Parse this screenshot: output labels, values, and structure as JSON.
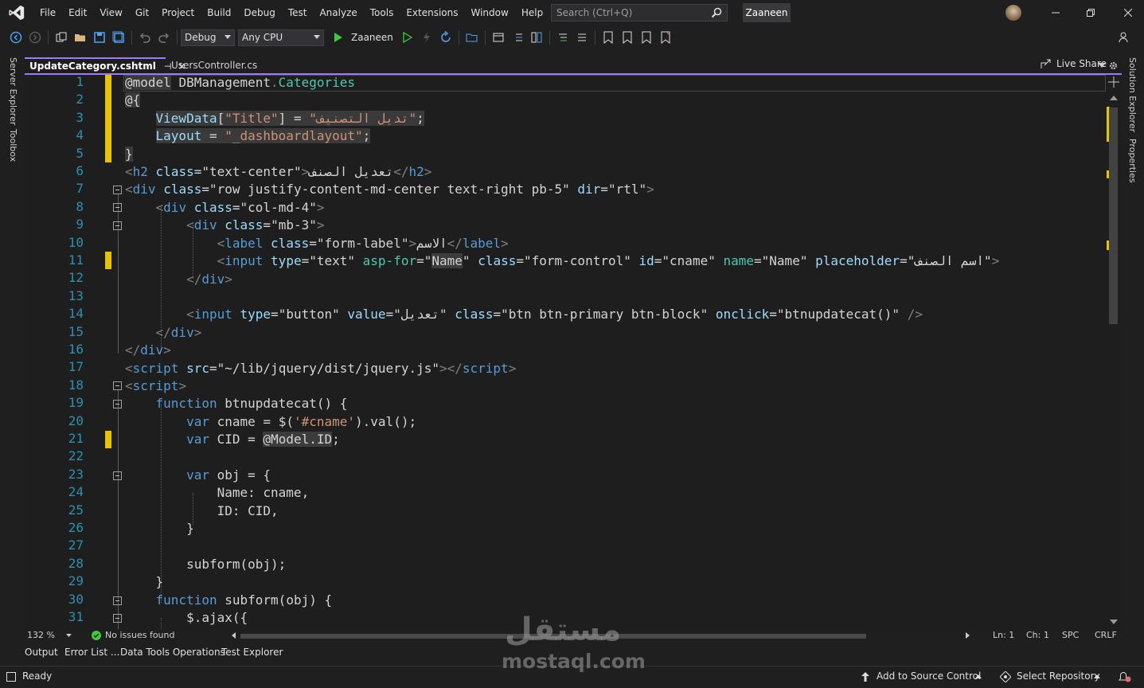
{
  "menu": {
    "items": [
      "File",
      "Edit",
      "View",
      "Git",
      "Project",
      "Build",
      "Debug",
      "Test",
      "Analyze",
      "Tools",
      "Extensions",
      "Window",
      "Help"
    ],
    "search_placeholder": "Search (Ctrl+Q)",
    "project_badge": "Zaaneen"
  },
  "toolbar": {
    "config": "Debug",
    "platform": "Any CPU",
    "run_target": "Zaaneen",
    "live_share": "Live Share"
  },
  "sidebars": {
    "left": [
      "Server Explorer",
      "Toolbox"
    ],
    "right": [
      "Solution Explorer",
      "Properties"
    ]
  },
  "tabs": [
    {
      "label": "UpdateCategory.cshtml",
      "pin": "⊣",
      "close": "×"
    },
    {
      "label": "UsersController.cs"
    }
  ],
  "editor": {
    "line_numbers": [
      "1",
      "2",
      "3",
      "4",
      "5",
      "6",
      "7",
      "8",
      "9",
      "10",
      "11",
      "12",
      "13",
      "14",
      "15",
      "16",
      "17",
      "18",
      "19",
      "20",
      "21",
      "22",
      "23",
      "24",
      "25",
      "26",
      "27",
      "28",
      "29",
      "30",
      "31"
    ]
  },
  "editor_status": {
    "zoom": "132 %",
    "issues": "No issues found",
    "line": "Ln: 1",
    "column": "Ch: 1",
    "whitespace": "SPC",
    "line_ending": "CRLF"
  },
  "bottom_tabs": [
    "Output",
    "Error List ...",
    "Data Tools Operations",
    "Test Explorer"
  ],
  "statusbar": {
    "state": "Ready",
    "source_control": "Add to Source Control",
    "repository": "Select Repository"
  },
  "watermark": {
    "arabic": "مستقل",
    "latin": "mostaql.com"
  }
}
